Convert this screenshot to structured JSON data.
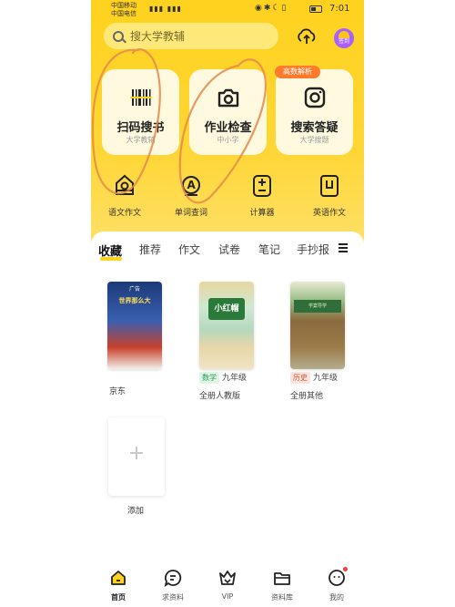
{
  "status": {
    "carrier1": "中国移动",
    "carrier2": "中国电信",
    "time": "7:01"
  },
  "search": {
    "placeholder": "搜大学教辅"
  },
  "header": {
    "sign_label": "签到"
  },
  "cards": [
    {
      "title": "扫码搜书",
      "subtitle": "大学教辅"
    },
    {
      "title": "作业检查",
      "subtitle": "中小学"
    },
    {
      "title": "搜索答疑",
      "subtitle": "大学搜题"
    }
  ],
  "card_tag": "高数解析",
  "tools": [
    "语文作文",
    "单词查词",
    "计算器",
    "英语作文"
  ],
  "tabs": [
    "收藏",
    "推荐",
    "作文",
    "试卷",
    "笔记",
    "手抄报"
  ],
  "books": [
    {
      "cover_title": "世界那么大",
      "ad": "广告",
      "label": "京东"
    },
    {
      "cover_title": "小红帽",
      "subject": "数学",
      "grade": "九年级",
      "desc": "全册人教版"
    },
    {
      "cover_title": "学案导学",
      "subject": "历史",
      "grade": "九年级",
      "desc": "全册其他"
    }
  ],
  "add_label": "添加",
  "nav": [
    "首页",
    "求资料",
    "VIP",
    "资料库",
    "我的"
  ],
  "colors": {
    "accent": "#ffd21f",
    "tag": "#ff7a2a",
    "annotation": "#e58a4a"
  }
}
